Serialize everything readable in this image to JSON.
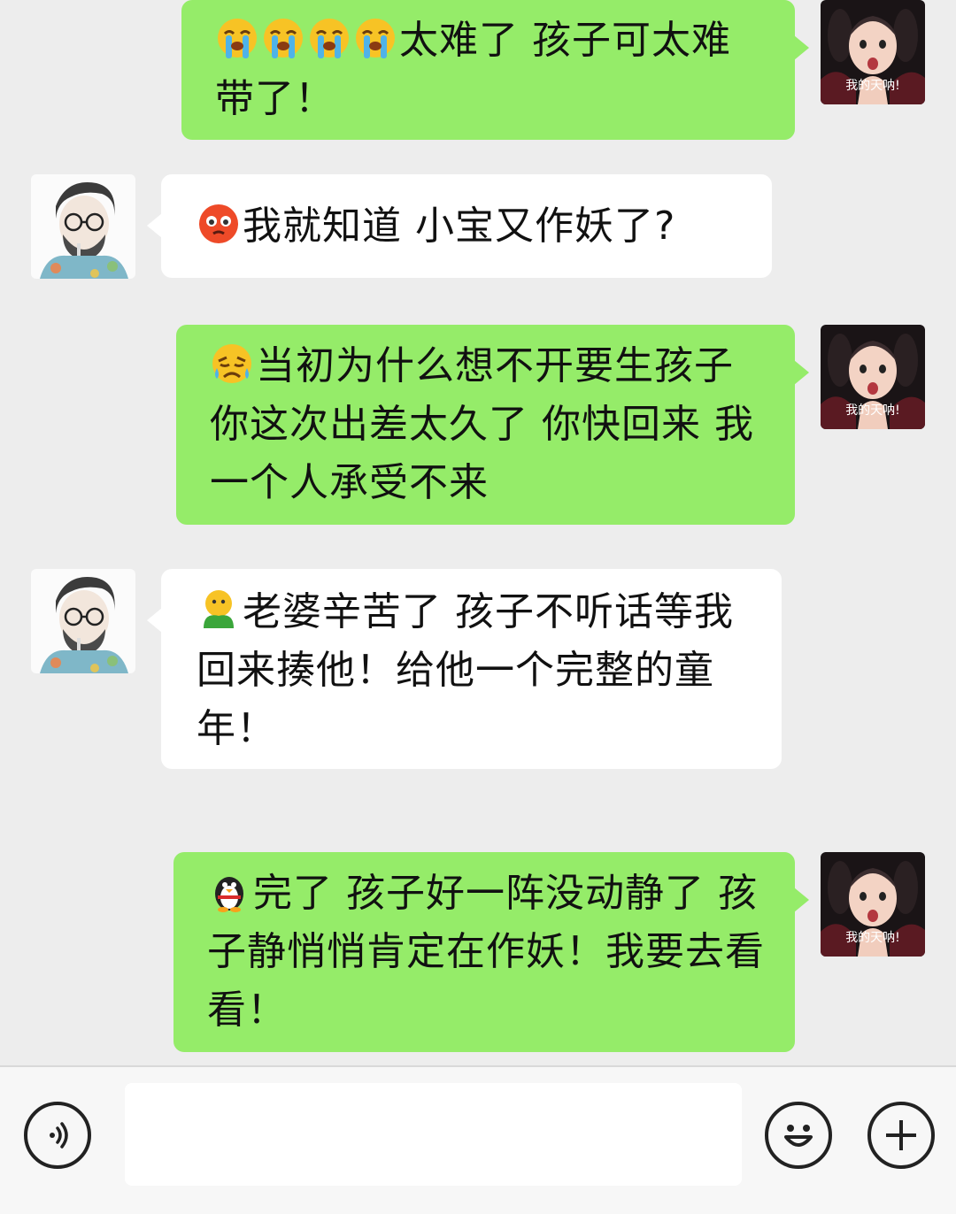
{
  "messages": [
    {
      "sender": "me",
      "emoji": [
        "loudly-crying-face-icon",
        "loudly-crying-face-icon",
        "loudly-crying-face-icon",
        "loudly-crying-face-icon"
      ],
      "text": "太难了 孩子可太难带了！"
    },
    {
      "sender": "them",
      "emoji": [
        "flushed-face-icon"
      ],
      "text": "我就知道 小宝又作妖了?"
    },
    {
      "sender": "me",
      "emoji": [
        "crying-face-icon"
      ],
      "text": "当初为什么想不开要生孩子 你这次出差太久了 你快回来 我一个人承受不来"
    },
    {
      "sender": "them",
      "emoji": [
        "green-doll-icon"
      ],
      "text": "老婆辛苦了 孩子不听话等我回来揍他！给他一个完整的童年！"
    },
    {
      "sender": "me",
      "emoji": [
        "penguin-icon"
      ],
      "text": "完了 孩子好一阵没动静了 孩子静悄悄肯定在作妖！我要去看看！"
    }
  ],
  "my_avatar": {
    "caption": "我的天呐!"
  },
  "their_avatar": {
    "icon": "sketch-man-avatar"
  },
  "input_bar": {
    "voice_icon": "voice-icon",
    "input_value": "",
    "emoji_icon": "smiley-face-icon",
    "plus_icon": "plus-icon"
  },
  "colors": {
    "me_bubble": "#95ec69",
    "them_bubble": "#ffffff",
    "background": "#ededed"
  }
}
